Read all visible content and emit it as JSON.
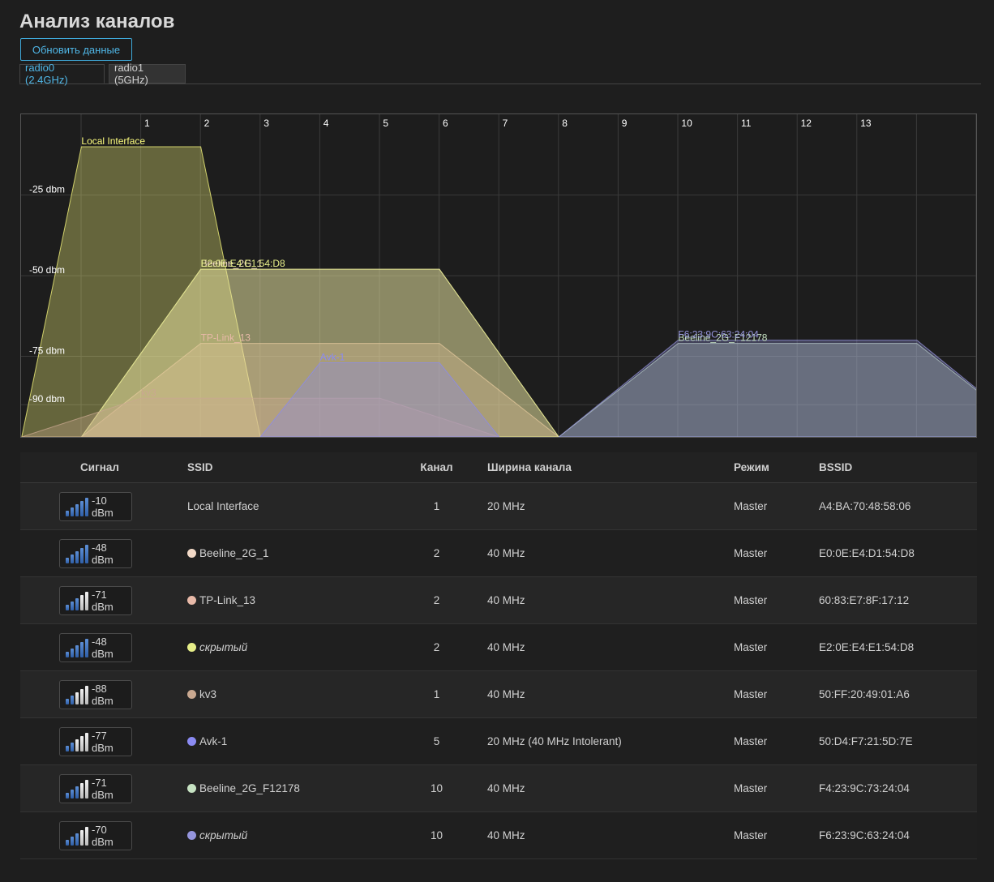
{
  "page": {
    "title": "Анализ каналов",
    "refresh_label": "Обновить данные",
    "tabs": [
      {
        "label": "radio0 (2.4GHz)",
        "active": true
      },
      {
        "label": "radio1 (5GHz)",
        "active": false
      }
    ]
  },
  "chart_data": {
    "type": "area",
    "x_channels": [
      "1",
      "2",
      "3",
      "4",
      "5",
      "6",
      "7",
      "8",
      "9",
      "10",
      "11",
      "12",
      "13"
    ],
    "y_ticks": [
      {
        "label": "-25 dbm",
        "value": -25
      },
      {
        "label": "-50 dbm",
        "value": -50
      },
      {
        "label": "-75 dbm",
        "value": -75
      },
      {
        "label": "-90 dbm",
        "value": -90
      }
    ],
    "ylim": [
      -100,
      -10
    ],
    "series": [
      {
        "name": "Local Interface",
        "channel": 1,
        "width_mhz": 20,
        "signal": -10,
        "color": "#ffff7f"
      },
      {
        "name": "Beeline_2G_1",
        "channel": 2,
        "width_mhz": 40,
        "signal": -48,
        "color": "#f2d9c7"
      },
      {
        "name": "TP-Link_13",
        "channel": 2,
        "width_mhz": 40,
        "signal": -71,
        "color": "#e8b9a8"
      },
      {
        "name": "E2:0E:E4:E1:54:D8",
        "channel": 2,
        "width_mhz": 40,
        "signal": -48,
        "color": "#e6ee88"
      },
      {
        "name": "kv3",
        "channel": 1,
        "width_mhz": 40,
        "signal": -88,
        "color": "#c9a890"
      },
      {
        "name": "Avk-1",
        "channel": 5,
        "width_mhz": 20,
        "signal": -77,
        "color": "#8a8af2"
      },
      {
        "name": "Beeline_2G_F12178",
        "channel": 10,
        "width_mhz": 40,
        "signal": -71,
        "color": "#c6e2c2"
      },
      {
        "name": "F6:23:9C:63:24:04",
        "channel": 10,
        "width_mhz": 40,
        "signal": -70,
        "color": "#9595dd"
      }
    ]
  },
  "table": {
    "headers": {
      "signal": "Сигнал",
      "ssid": "SSID",
      "channel": "Канал",
      "width": "Ширина канала",
      "mode": "Режим",
      "bssid": "BSSID"
    },
    "rows": [
      {
        "signal": "-10 dBm",
        "level": 5,
        "ssid": "Local Interface",
        "hidden": false,
        "dot": "",
        "channel": "1",
        "width": "20 MHz",
        "mode": "Master",
        "bssid": "A4:BA:70:48:58:06"
      },
      {
        "signal": "-48 dBm",
        "level": 5,
        "ssid": "Beeline_2G_1",
        "hidden": false,
        "dot": "#f2d9c7",
        "channel": "2",
        "width": "40 MHz",
        "mode": "Master",
        "bssid": "E0:0E:E4:D1:54:D8"
      },
      {
        "signal": "-71 dBm",
        "level": 3,
        "ssid": "TP-Link_13",
        "hidden": false,
        "dot": "#e8b9a8",
        "channel": "2",
        "width": "40 MHz",
        "mode": "Master",
        "bssid": "60:83:E7:8F:17:12"
      },
      {
        "signal": "-48 dBm",
        "level": 5,
        "ssid": "скрытый",
        "hidden": true,
        "dot": "#e6ee88",
        "channel": "2",
        "width": "40 MHz",
        "mode": "Master",
        "bssid": "E2:0E:E4:E1:54:D8"
      },
      {
        "signal": "-88 dBm",
        "level": 2,
        "ssid": "kv3",
        "hidden": false,
        "dot": "#c9a890",
        "channel": "1",
        "width": "40 MHz",
        "mode": "Master",
        "bssid": "50:FF:20:49:01:A6"
      },
      {
        "signal": "-77 dBm",
        "level": 2,
        "ssid": "Avk-1",
        "hidden": false,
        "dot": "#8a8af2",
        "channel": "5",
        "width": "20 MHz (40 MHz Intolerant)",
        "mode": "Master",
        "bssid": "50:D4:F7:21:5D:7E"
      },
      {
        "signal": "-71 dBm",
        "level": 3,
        "ssid": "Beeline_2G_F12178",
        "hidden": false,
        "dot": "#c6e2c2",
        "channel": "10",
        "width": "40 MHz",
        "mode": "Master",
        "bssid": "F4:23:9C:73:24:04"
      },
      {
        "signal": "-70 dBm",
        "level": 3,
        "ssid": "скрытый",
        "hidden": true,
        "dot": "#9595dd",
        "channel": "10",
        "width": "40 MHz",
        "mode": "Master",
        "bssid": "F6:23:9C:63:24:04"
      }
    ]
  }
}
